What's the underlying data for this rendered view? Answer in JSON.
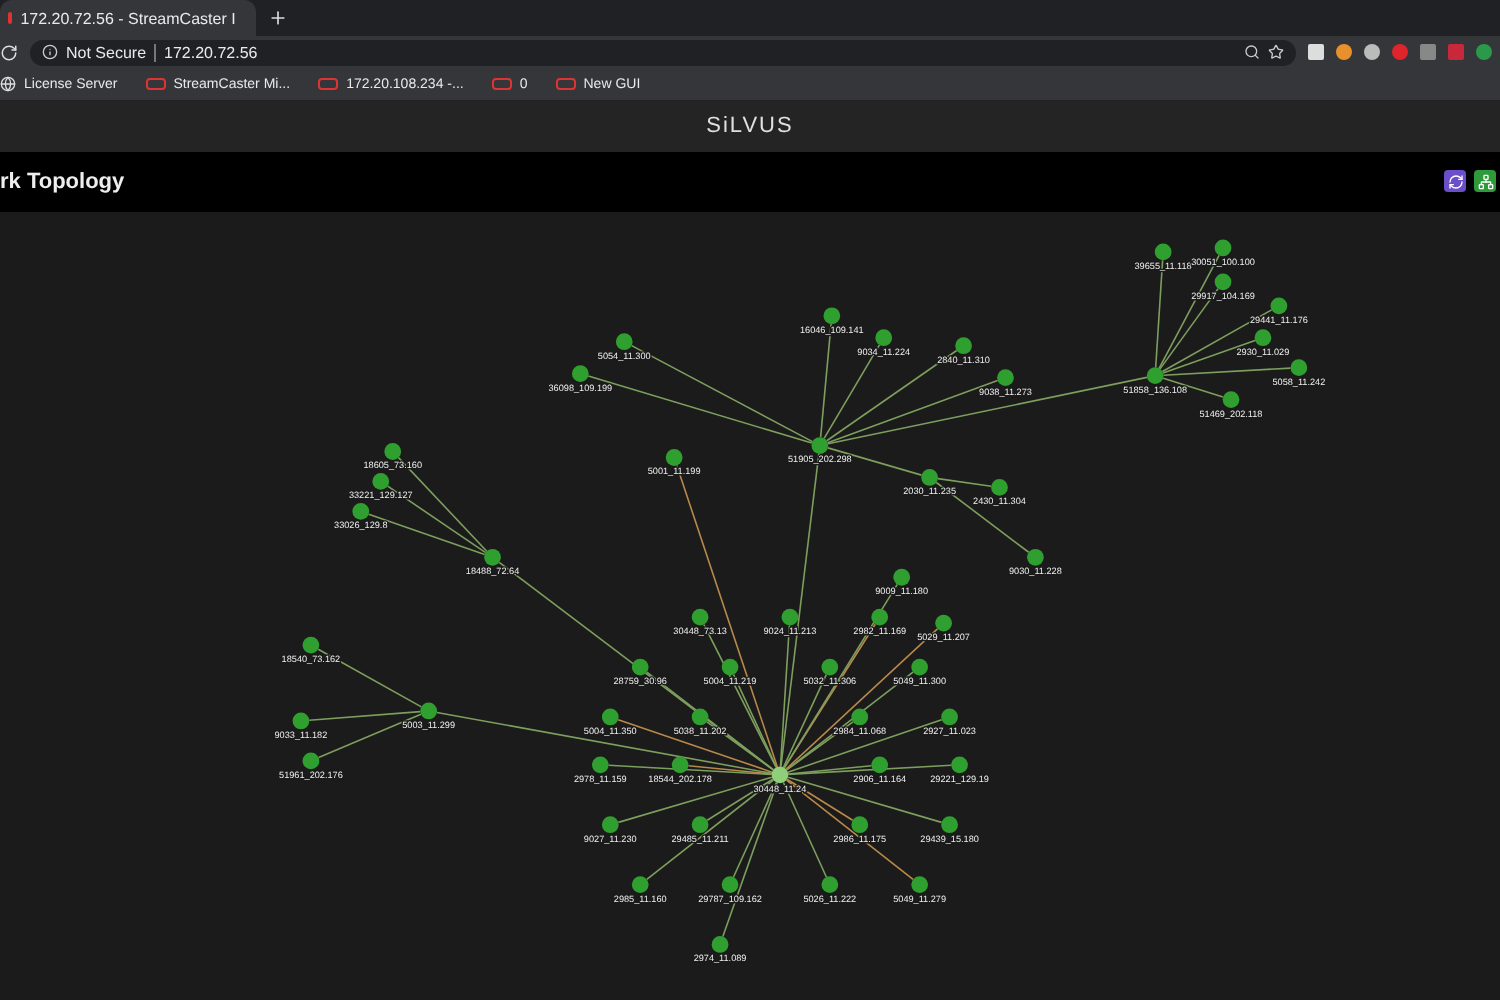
{
  "browser": {
    "tab": {
      "title": "172.20.72.56 - StreamCaster I"
    },
    "security": "Not Secure",
    "url": "172.20.72.56",
    "bookmarks": [
      "License Server",
      "StreamCaster Mi...",
      "172.20.108.234 -...",
      "0",
      "New GUI"
    ]
  },
  "header": {
    "logo": "SiLVUS"
  },
  "page": {
    "title": "rk Topology"
  },
  "topology": {
    "label": "30448_11.24",
    "children": [
      {
        "label": "30448_73.13"
      },
      {
        "label": "9024_11.213"
      },
      {
        "label": "2982_11.169"
      },
      {
        "label": "28759_30.96"
      },
      {
        "label": "5004_11.219"
      },
      {
        "label": "5032_11.306"
      },
      {
        "label": "5049_11.300"
      },
      {
        "label": "5004_11.350"
      },
      {
        "label": "5038_11.202"
      },
      {
        "label": "2984_11.068"
      },
      {
        "label": "2927_11.023"
      },
      {
        "label": "2978_11.159"
      },
      {
        "label": "18544_202.178"
      },
      {
        "label": "2906_11.164"
      },
      {
        "label": "29221_129.19"
      },
      {
        "label": "9027_11.230"
      },
      {
        "label": "29485_11.211"
      },
      {
        "label": "2986_11.175"
      },
      {
        "label": "29439_15.180"
      },
      {
        "label": "2985_11.160"
      },
      {
        "label": "29787_109.162"
      },
      {
        "label": "5026_11.222"
      },
      {
        "label": "5049_11.279"
      },
      {
        "label": "2974_11.089"
      },
      {
        "label": "5003_11.299",
        "children": [
          {
            "label": "18540_73.162"
          },
          {
            "label": "9033_11.182"
          },
          {
            "label": "51961_202.176"
          }
        ]
      },
      {
        "label": "18488_72.64",
        "children": [
          {
            "label": "18605_73.160"
          },
          {
            "label": "33221_129.127"
          },
          {
            "label": "33026_129.8"
          }
        ]
      },
      {
        "label": "5001_11.199"
      },
      {
        "label": "51905_202.298",
        "children": [
          {
            "label": "5054_11.300"
          },
          {
            "label": "36098_109.199"
          },
          {
            "label": "16046_109.141"
          },
          {
            "label": "9034_11.224"
          },
          {
            "label": "2840_11.310"
          },
          {
            "label": "9038_11.273"
          },
          {
            "label": "2030_11.235",
            "children": [
              {
                "label": "2430_11.304"
              },
              {
                "label": "9030_11.228"
              }
            ]
          },
          {
            "label": "51858_136.108",
            "children": [
              {
                "label": "39655_11.118"
              },
              {
                "label": "30051_100.100"
              },
              {
                "label": "29917_104.169"
              },
              {
                "label": "29441_11.176"
              },
              {
                "label": "2930_11.029"
              },
              {
                "label": "5058_11.242"
              },
              {
                "label": "51469_202.118"
              }
            ]
          }
        ]
      },
      {
        "label": "9009_11.180"
      },
      {
        "label": "5029_11.207"
      }
    ]
  }
}
